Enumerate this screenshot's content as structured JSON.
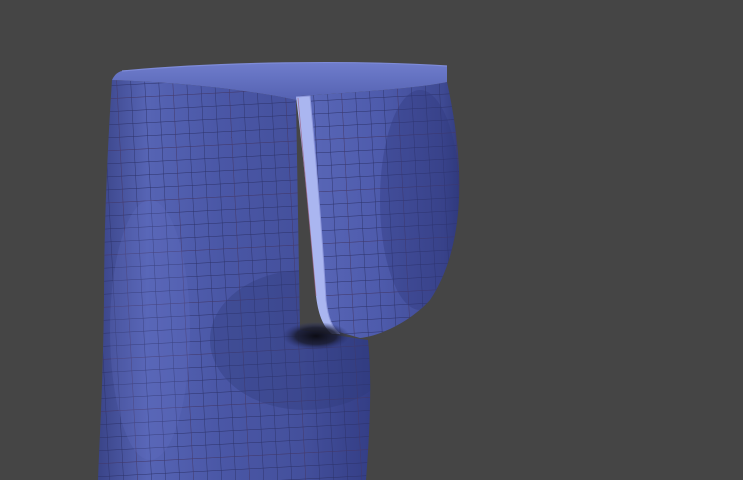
{
  "viewport": {
    "background_color": "#454545",
    "mesh_base_color": "#4a56a0",
    "mesh_highlight_color": "#7c8ad6",
    "mesh_shadow_color": "#2a3270",
    "wire_color": "#2f3470",
    "seam_color": "#b4bff2",
    "seam_edge_color": "#8a93d8",
    "cavity_color": "#14141e",
    "edge_accent_color": "#b05a6a"
  }
}
